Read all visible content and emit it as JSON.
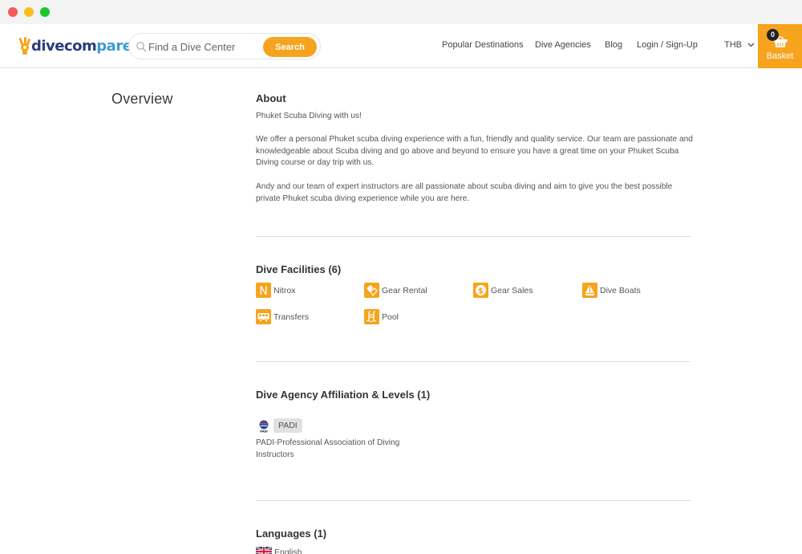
{
  "window": {
    "controls": [
      "close",
      "minimize",
      "maximize"
    ]
  },
  "header": {
    "logo": {
      "part1": "dive",
      "part2": "com",
      "part3": "pare"
    },
    "search": {
      "placeholder": "Find a Dive Center",
      "value": "",
      "button_label": "Search"
    },
    "nav": [
      {
        "label": "Popular Destinations"
      },
      {
        "label": "Dive Agencies"
      },
      {
        "label": "Blog"
      },
      {
        "label": "Login / Sign-Up"
      }
    ],
    "currency": "THB",
    "basket": {
      "label": "Basket",
      "count": "0"
    }
  },
  "colors": {
    "accent": "#f6a41d",
    "logo_dark": "#2a3c78",
    "logo_light": "#3b9bd6",
    "divider": "#dcdcdc"
  },
  "page": {
    "section_title": "Overview",
    "about": {
      "heading": "About",
      "paragraphs": [
        "Phuket Scuba Diving with us!",
        "We offer a personal Phuket scuba diving experience with a fun, friendly and quality service. Our team are passionate and knowledgeable about Scuba diving and go above and beyond to ensure you have a great time on your Phuket Scuba Diving course or day trip with us.",
        "Andy and our team of expert instructors are all passionate about scuba diving and aim to give you the best possible private Phuket scuba diving experience while you are here."
      ]
    },
    "facilities": {
      "heading": "Dive Facilities (6)",
      "items": [
        {
          "label": "Nitrox",
          "icon": "nitrox-icon"
        },
        {
          "label": "Gear Rental",
          "icon": "fins-icon"
        },
        {
          "label": "Gear Sales",
          "icon": "dollar-icon"
        },
        {
          "label": "Dive Boats",
          "icon": "sailboat-icon"
        },
        {
          "label": "Transfers",
          "icon": "bus-icon"
        },
        {
          "label": "Pool",
          "icon": "pool-ladder-icon"
        }
      ]
    },
    "agency": {
      "heading": "Dive Agency Affiliation & Levels (1)",
      "badge": "PADI",
      "description": "PADI-Professional Association of Diving Instructors"
    },
    "languages": {
      "heading": "Languages (1)",
      "items": [
        {
          "label": "English",
          "icon": "uk-flag-icon"
        }
      ]
    }
  }
}
